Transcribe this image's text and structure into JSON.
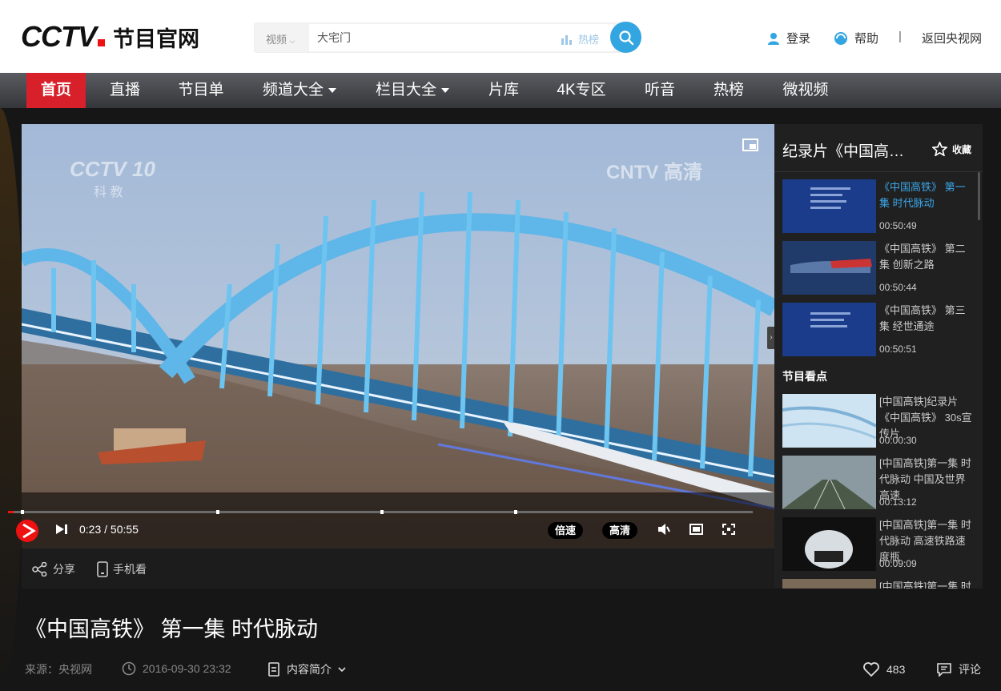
{
  "header": {
    "logo_text": "CCTV",
    "logo_sub": "节目官网",
    "search": {
      "category": "视频",
      "value": "大宅门",
      "hot_label": "热榜"
    },
    "links": {
      "login": "登录",
      "help": "帮助",
      "divider": "|",
      "back": "返回央视网"
    }
  },
  "nav": {
    "items": [
      {
        "label": "首页",
        "active": true
      },
      {
        "label": "直播"
      },
      {
        "label": "节目单"
      },
      {
        "label": "频道大全",
        "dropdown": true
      },
      {
        "label": "栏目大全",
        "dropdown": true
      },
      {
        "label": "片库"
      },
      {
        "label": "4K专区"
      },
      {
        "label": "听音"
      },
      {
        "label": "热榜"
      },
      {
        "label": "微视频"
      }
    ]
  },
  "player": {
    "channel_logo": "CCTV 10",
    "channel_sub": "科 教",
    "watermark": "CNTV 高清",
    "time": "0:23 / 50:55",
    "progress": 0.0075,
    "speed_label": "倍速",
    "quality_label": "高清"
  },
  "actions": {
    "share": "分享",
    "mobile": "手机看"
  },
  "sidebar": {
    "title": "纪录片《中国高…",
    "favorite_label": "收藏",
    "episodes": [
      {
        "title": "《中国高铁》 第一集 时代脉动",
        "duration": "00:50:49",
        "current": true
      },
      {
        "title": "《中国高铁》 第二集 创新之路",
        "duration": "00:50:44"
      },
      {
        "title": "《中国高铁》 第三集 经世通途",
        "duration": "00:50:51"
      }
    ],
    "section_title": "节目看点",
    "highlights": [
      {
        "title": "[中国高铁]纪录片《中国高铁》 30s宣传片",
        "duration": "00:00:30"
      },
      {
        "title": "[中国高铁]第一集 时代脉动 中国及世界高速",
        "duration": "00:13:12"
      },
      {
        "title": "[中国高铁]第一集 时代脉动 高速铁路速度瓶",
        "duration": "00:09:09"
      },
      {
        "title": "[中国高铁]第一集 时代",
        "duration": ""
      }
    ]
  },
  "video": {
    "title": "《中国高铁》 第一集 时代脉动",
    "source": "来源：央视网",
    "date": "2016-09-30 23:32",
    "intro_label": "内容简介",
    "likes": "483",
    "comment_label": "评论"
  }
}
